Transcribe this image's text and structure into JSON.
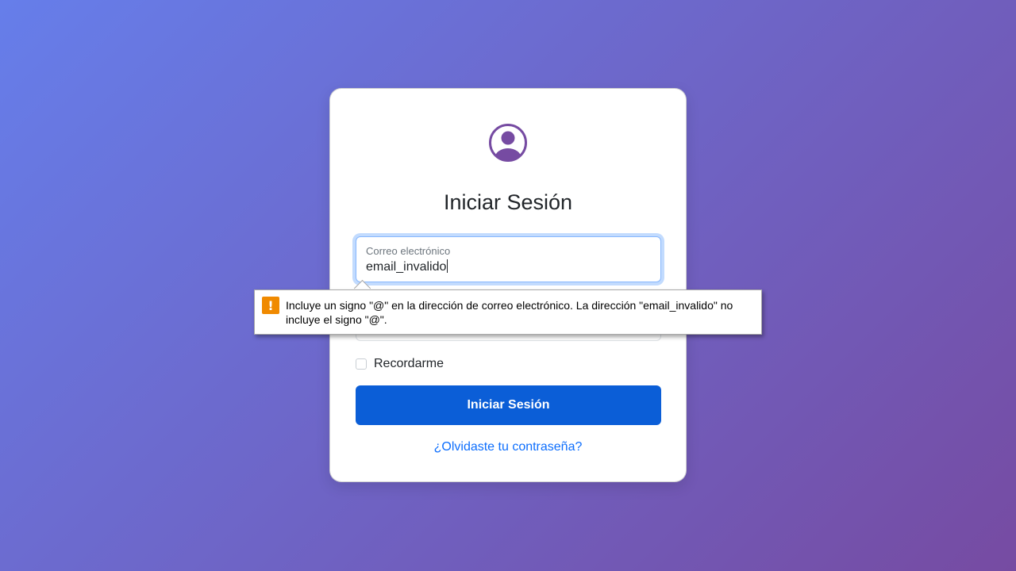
{
  "login": {
    "title": "Iniciar Sesión",
    "email": {
      "label": "Correo electrónico",
      "value": "email_invalido"
    },
    "remember_label": "Recordarme",
    "submit_label": "Iniciar Sesión",
    "forgot_label": "¿Olvidaste tu contraseña?"
  },
  "validation_tooltip": {
    "icon": "warning-icon",
    "symbol": "!",
    "message": "Incluye un signo \"@\" en la dirección de correo electrónico. La dirección \"email_invalido\" no incluye el signo \"@\"."
  },
  "colors": {
    "accent": "#764ba2",
    "primary_button": "#0b5ed7",
    "link": "#0d6efd",
    "warning": "#f08a00"
  }
}
